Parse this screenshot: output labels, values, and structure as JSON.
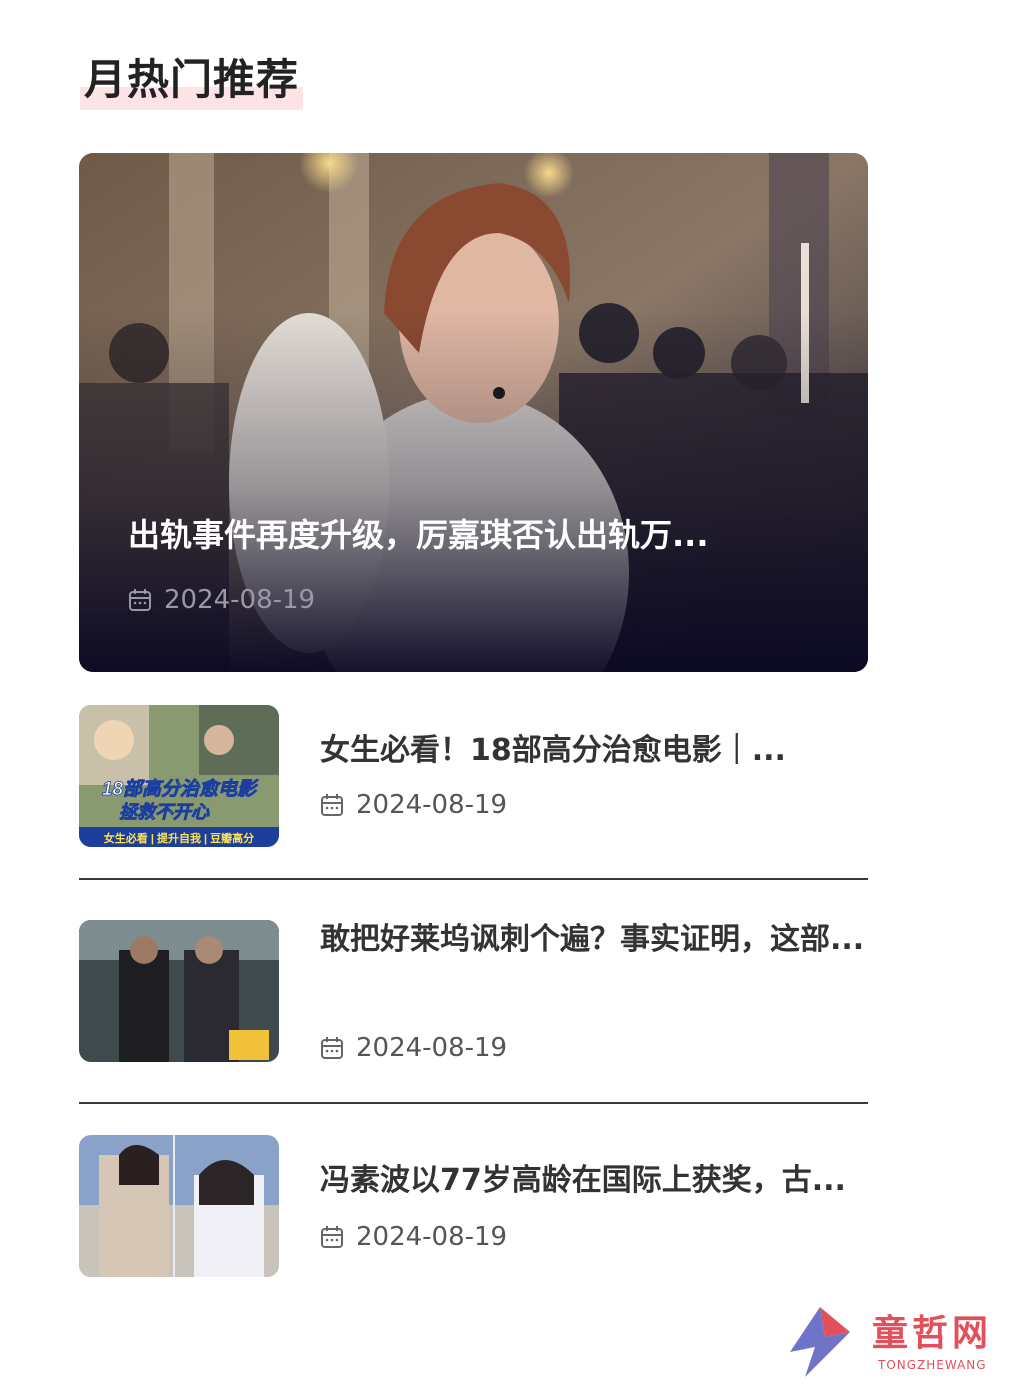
{
  "section": {
    "title": "月热门推荐"
  },
  "hero": {
    "title": "出轨事件再度升级，厉嘉琪否认出轨万...",
    "date": "2024-08-19"
  },
  "items": [
    {
      "title": "女生必看！18部高分治愈电影｜...",
      "date": "2024-08-19",
      "thumb_text": {
        "line1": "18部高分治愈电影",
        "line2": "拯救不开心",
        "footer": "女生必看 | 提升自我 | 豆瓣高分"
      }
    },
    {
      "title": "敢把好莱坞讽刺个遍？事实证明，这部...",
      "date": "2024-08-19"
    },
    {
      "title": "冯素波以77岁高龄在国际上获奖，古...",
      "date": "2024-08-19"
    }
  ],
  "watermark": {
    "name": "童哲网",
    "sub": "TONGZHEWANG"
  },
  "colors": {
    "accent_underline": "#fde3e6",
    "text": "#333333",
    "date_grey": "#555555"
  }
}
